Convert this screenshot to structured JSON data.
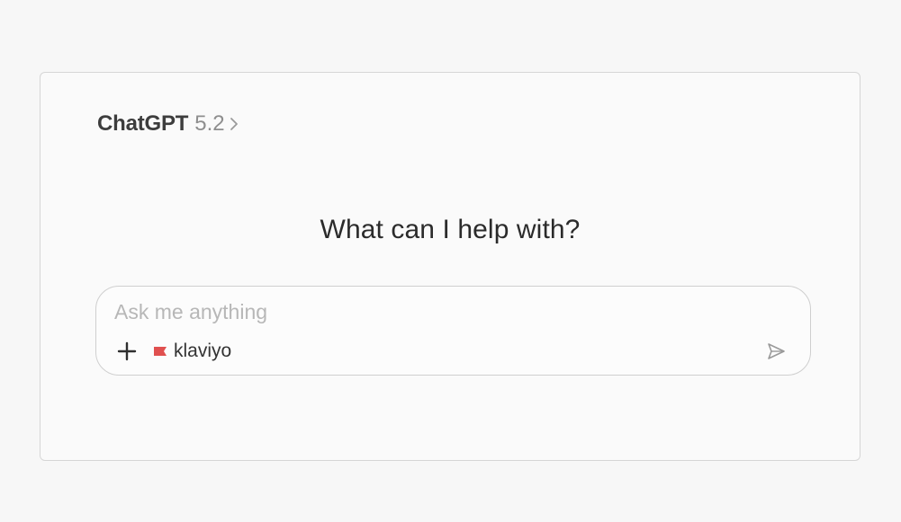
{
  "header": {
    "model_name": "ChatGPT",
    "model_version": "5.2",
    "chevron_icon": "chevron-right-icon"
  },
  "main": {
    "heading": "What can I help with?"
  },
  "composer": {
    "placeholder": "Ask me anything",
    "value": "",
    "add_icon": "plus-icon",
    "connector": {
      "label": "klaviyo",
      "icon": "flag-icon",
      "icon_color": "#e0504f"
    },
    "send_icon": "send-icon"
  }
}
